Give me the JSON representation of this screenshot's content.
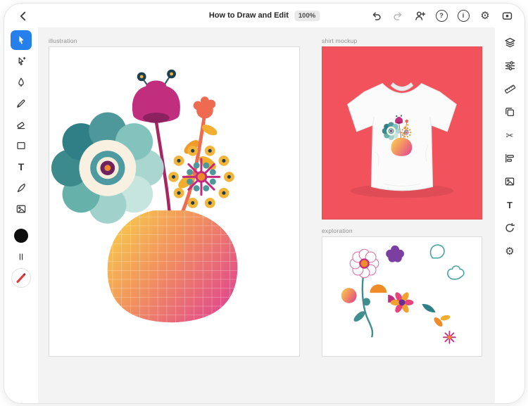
{
  "window": {
    "title": "How to Draw and Edit",
    "zoom_badge": "100%"
  },
  "header": {
    "actions": [
      {
        "name": "undo"
      },
      {
        "name": "redo",
        "disabled": true
      },
      {
        "name": "invite-collaborator"
      },
      {
        "name": "help",
        "glyph": "?"
      },
      {
        "name": "info",
        "glyph": "i"
      },
      {
        "name": "settings",
        "glyph": "⚙"
      },
      {
        "name": "touch-shortcuts"
      }
    ]
  },
  "tools_left": [
    {
      "name": "select-tool",
      "active": true
    },
    {
      "name": "direct-select-tool"
    },
    {
      "name": "pen-tool"
    },
    {
      "name": "pencil-tool"
    },
    {
      "name": "eraser-tool"
    },
    {
      "name": "shape-tool"
    },
    {
      "name": "type-tool",
      "glyph": "T"
    },
    {
      "name": "knife-tool"
    },
    {
      "name": "place-image-tool"
    },
    {
      "name": "fill-color-well"
    },
    {
      "name": "stroke-width-control"
    },
    {
      "name": "brush-indicator"
    }
  ],
  "tools_right": [
    {
      "name": "layers-panel"
    },
    {
      "name": "properties-panel"
    },
    {
      "name": "precision-panel"
    },
    {
      "name": "duplicate-action"
    },
    {
      "name": "scissors-action",
      "glyph": "✂"
    },
    {
      "name": "align-panel"
    },
    {
      "name": "image-panel"
    },
    {
      "name": "type-panel",
      "glyph": "T"
    },
    {
      "name": "rotate-history"
    },
    {
      "name": "app-settings",
      "glyph": "⚙"
    }
  ],
  "artboards": [
    {
      "label": "illustration"
    },
    {
      "label": "shirt mockup"
    },
    {
      "label": "exploration"
    }
  ],
  "colors": {
    "tool_active": "#2680eb",
    "canvas_bg": "#f3f3f4",
    "shirt_board_bg": "#f2525c",
    "vase_gradient": [
      "#f7ce4b",
      "#f2935d",
      "#e14a8b"
    ],
    "teal": "#4e979a",
    "magenta": "#c22a7e",
    "orange": "#ee8a2b",
    "plum": "#6e2360"
  }
}
